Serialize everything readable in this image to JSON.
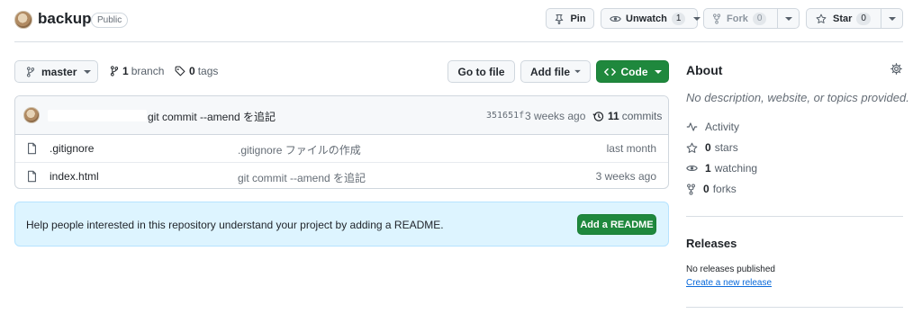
{
  "repo": {
    "name": "backup",
    "visibility": "Public"
  },
  "header_actions": {
    "pin": "Pin",
    "unwatch": "Unwatch",
    "watch_count": "1",
    "fork": "Fork",
    "fork_count": "0",
    "star": "Star",
    "star_count": "0"
  },
  "file_nav": {
    "branch": "master",
    "branch_count": "1",
    "branch_label": "branch",
    "tag_count": "0",
    "tag_label": "tags",
    "go_to_file": "Go to file",
    "add_file": "Add file",
    "code": "Code"
  },
  "latest_commit": {
    "message": "git commit --amend を追記",
    "sha": "351651f",
    "time": "3 weeks ago",
    "commit_count": "11",
    "commit_label": "commits"
  },
  "files": [
    {
      "name": ".gitignore",
      "message": ".gitignore ファイルの作成",
      "time": "last month"
    },
    {
      "name": "index.html",
      "message": "git commit --amend を追記",
      "time": "3 weeks ago"
    }
  ],
  "readme_banner": {
    "text": "Help people interested in this repository understand your project by adding a README.",
    "button": "Add a README"
  },
  "about": {
    "title": "About",
    "description": "No description, website, or topics provided.",
    "activity": "Activity",
    "stars_count": "0",
    "stars_label": "stars",
    "watching_count": "1",
    "watching_label": "watching",
    "forks_count": "0",
    "forks_label": "forks"
  },
  "releases": {
    "title": "Releases",
    "empty": "No releases published",
    "create_link": "Create a new release"
  },
  "colors": {
    "accent_green": "#1f883d",
    "link_blue": "#0969da",
    "banner_blue": "#ddf4ff"
  }
}
